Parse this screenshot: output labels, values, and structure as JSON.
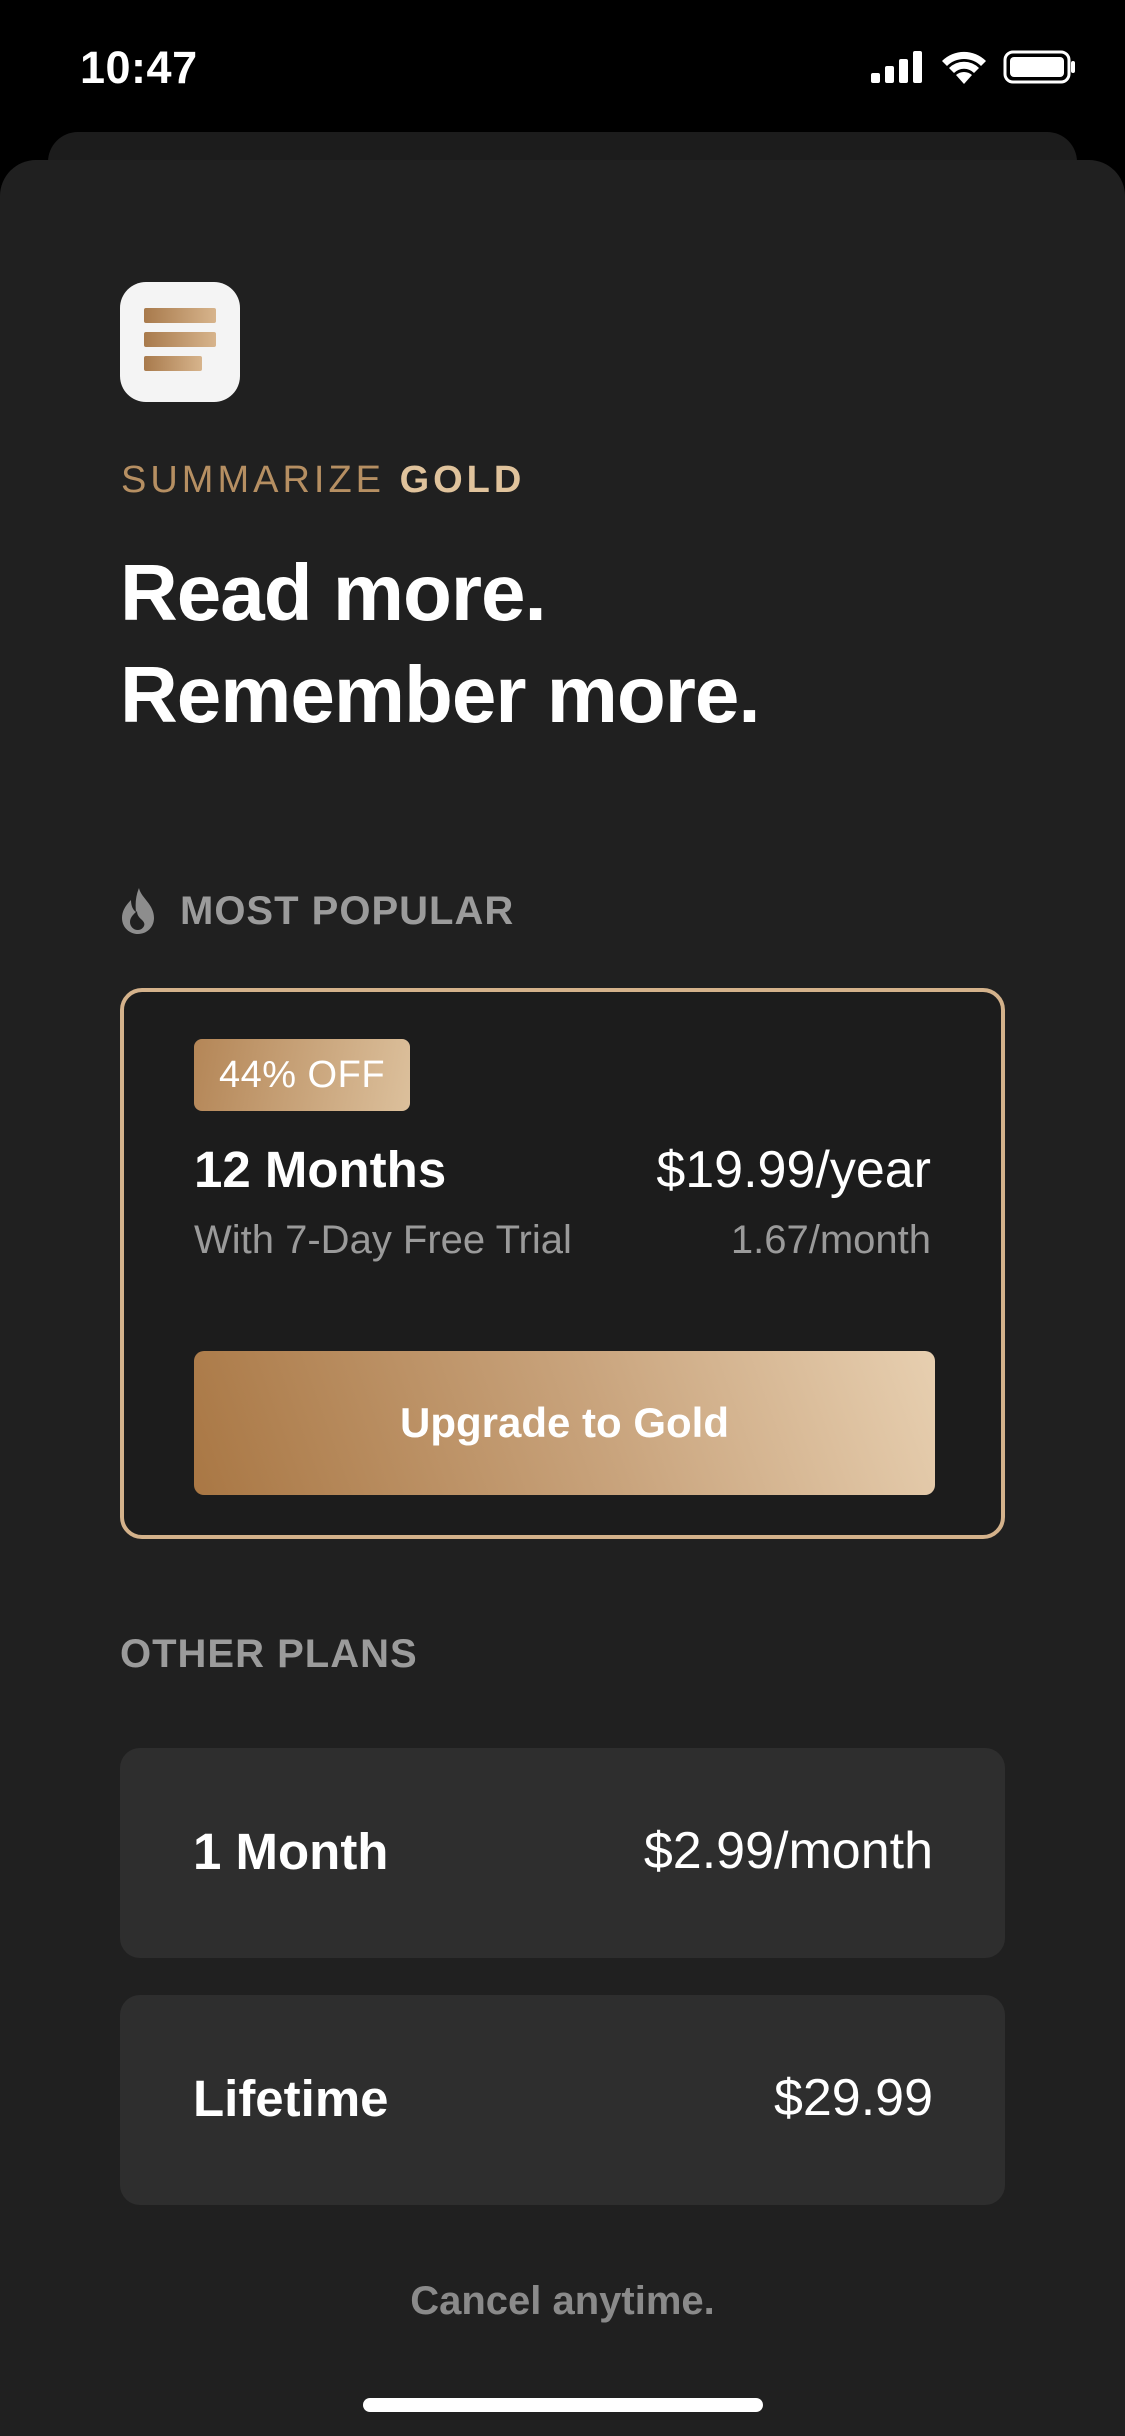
{
  "status_bar": {
    "time": "10:47",
    "signal_icon": "cellular-signal-icon",
    "wifi_icon": "wifi-icon",
    "battery_icon": "battery-icon"
  },
  "header": {
    "app_icon": "summarize-app-icon",
    "brand_prefix": "SUMMARIZE",
    "brand_tier": "GOLD",
    "headline_line1": "Read more.",
    "headline_line2": "Remember more."
  },
  "featured": {
    "section_icon": "flame-icon",
    "section_label": "MOST POPULAR",
    "badge": "44% OFF",
    "plan_name": "12 Months",
    "plan_subtitle": "With 7-Day Free Trial",
    "price": "$19.99/year",
    "monthly_price": "1.67/month",
    "cta_label": "Upgrade to Gold"
  },
  "other_plans": {
    "section_label": "OTHER PLANS",
    "plans": [
      {
        "name": "1 Month",
        "price": "$2.99/month"
      },
      {
        "name": "Lifetime",
        "price": "$29.99"
      }
    ]
  },
  "footer": {
    "note": "Cancel anytime."
  },
  "colors": {
    "background": "#202020",
    "gold_accent": "#d4b28b",
    "gold_dark": "#a97744",
    "muted_text": "#9b9b9b"
  }
}
